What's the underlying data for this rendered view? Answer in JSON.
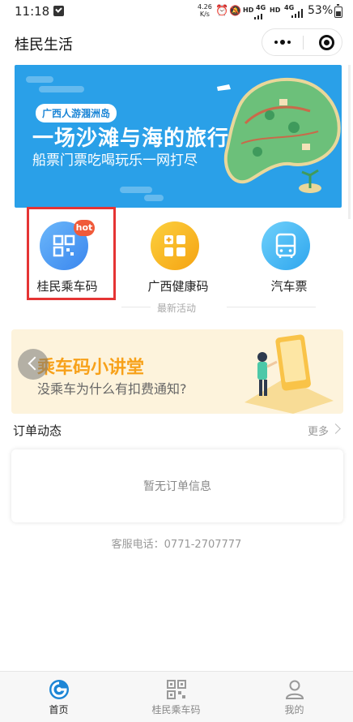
{
  "status_bar": {
    "time": "11:18",
    "net_speed_value": "4.26",
    "net_speed_unit": "K/s",
    "hd1": "HD",
    "hd2": "HD",
    "lte1": "4G",
    "lte2": "4G",
    "battery": "53%"
  },
  "nav": {
    "title": "桂民生活"
  },
  "banner": {
    "tag": "广西人游涠洲岛",
    "title": "一场沙滩与海的旅行",
    "subtitle": "船票门票吃喝玩乐一网打尽"
  },
  "services": [
    {
      "label": "桂民乘车码",
      "badge": "hot",
      "icon": "qr-code-icon",
      "color": "#4a9ef5"
    },
    {
      "label": "广西健康码",
      "icon": "health-code-icon",
      "color": "#f9b21b"
    },
    {
      "label": "汽车票",
      "icon": "bus-icon",
      "color": "#45b8f0"
    }
  ],
  "section": {
    "latest_label": "最新活动"
  },
  "promo": {
    "title": "乘车码小讲堂",
    "subtitle": "没乘车为什么有扣费通知?"
  },
  "orders": {
    "title": "订单动态",
    "more": "更多",
    "empty": "暂无订单信息"
  },
  "hotline": "客服电话：0771-2707777",
  "tabs": [
    {
      "label": "首页",
      "icon": "home-logo-icon",
      "active": true
    },
    {
      "label": "桂民乘车码",
      "icon": "qr-code-icon",
      "active": false
    },
    {
      "label": "我的",
      "icon": "person-icon",
      "active": false
    }
  ],
  "colors": {
    "accent_blue": "#1d86d6",
    "banner_blue": "#2aa0e8",
    "highlight_red": "#e53434",
    "promo_orange": "#f7a11a"
  }
}
